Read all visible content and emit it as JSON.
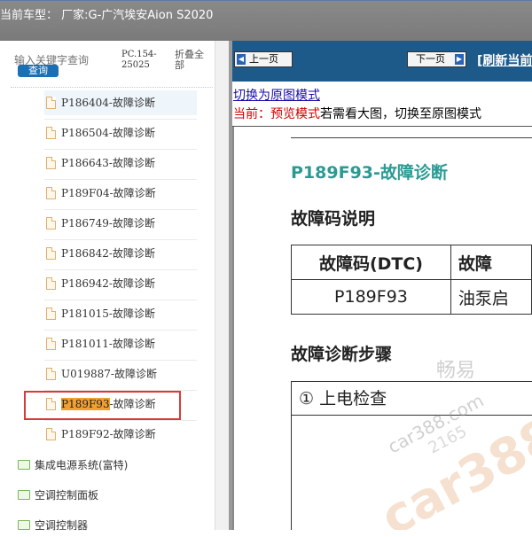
{
  "header": {
    "vehicle_label": "当前车型： 厂家:G-广汽埃安Aion S2020"
  },
  "sidebar": {
    "search_placeholder": "输入关键字查询",
    "search_button": "查询",
    "doc_code": "PC.154-25025",
    "collapse_all": "折叠全部",
    "items": [
      {
        "label": "P186404-故障诊断",
        "active": true
      },
      {
        "label": "P186504-故障诊断"
      },
      {
        "label": "P186643-故障诊断"
      },
      {
        "label": "P189F04-故障诊断"
      },
      {
        "label": "P186749-故障诊断"
      },
      {
        "label": "P186842-故障诊断"
      },
      {
        "label": "P186942-故障诊断"
      },
      {
        "label": "P181015-故障诊断"
      },
      {
        "label": "P181011-故障诊断"
      },
      {
        "label": "U019887-故障诊断"
      },
      {
        "code": "P189F93",
        "suffix": "-故障诊断",
        "selected": true
      },
      {
        "label": "P189F92-故障诊断"
      }
    ],
    "folders": [
      "集成电源系统(富特)",
      "空调控制面板",
      "空调控制器"
    ]
  },
  "viewer": {
    "prev_label": "上一页",
    "next_label": "下一页",
    "refresh_label": "[刷新当前",
    "switch_link": "切换为原图模式",
    "status_prefix": "当前：预览模式",
    "status_suffix": "若需看大图，切换至原图模式"
  },
  "document": {
    "title": "P189F93-故障诊断",
    "dtc_section": "故障码说明",
    "table": {
      "headers": [
        "故障码(DTC)",
        "故障"
      ],
      "rows": [
        [
          "P189F93",
          "油泵启"
        ]
      ]
    },
    "steps_section": "故障诊断步骤",
    "step_1": "① 上电检查"
  },
  "watermark": {
    "cn": "畅易",
    "site": "car388.com",
    "id": "2165",
    "logo": "car388"
  },
  "colors": {
    "title_teal": "#2a9a93",
    "nav_blue": "#1d5a8a",
    "highlight_red": "#d83a3a",
    "code_highlight": "#f0a030"
  }
}
